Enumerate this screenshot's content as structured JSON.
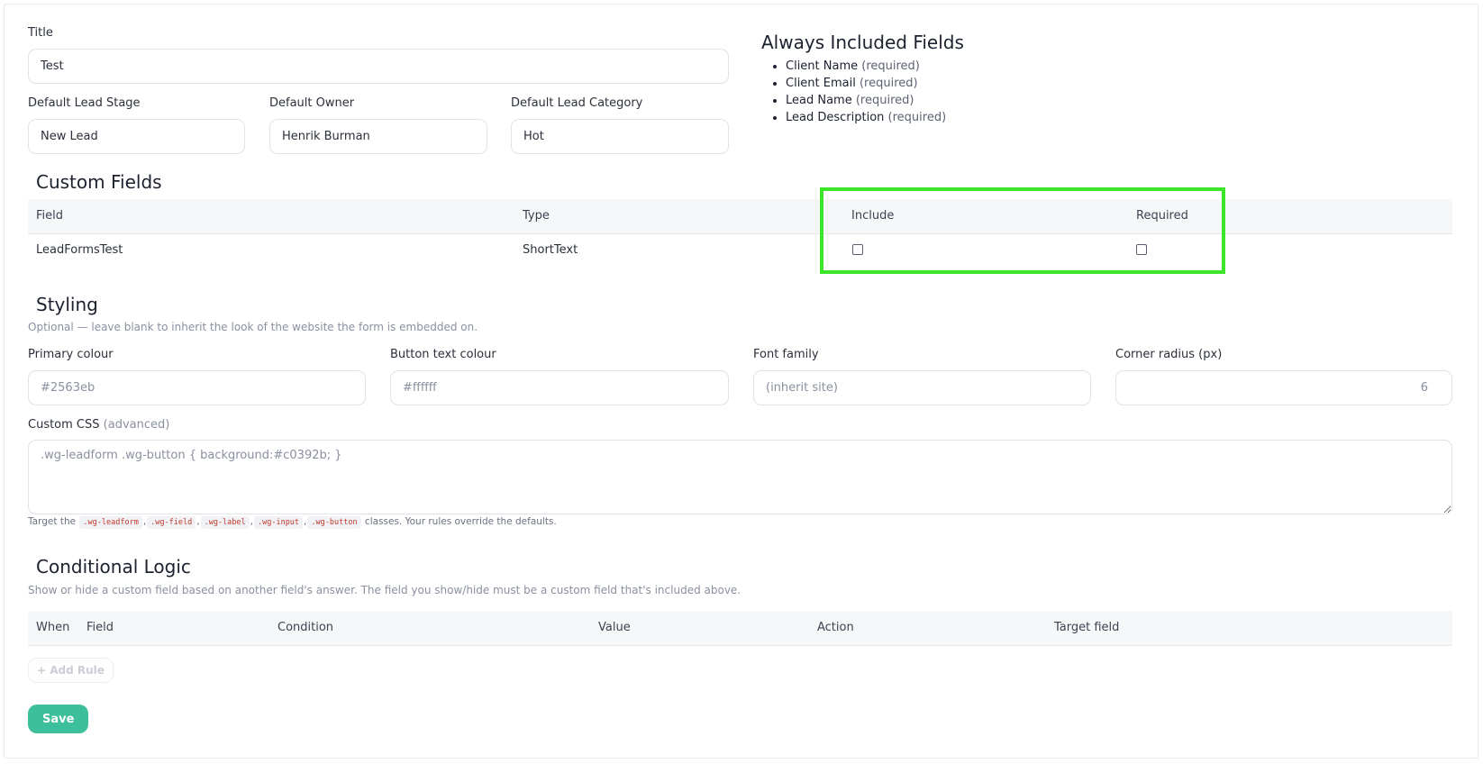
{
  "form": {
    "title_label": "Title",
    "title_value": "Test",
    "lead_stage_label": "Default Lead Stage",
    "lead_stage_value": "New Lead",
    "owner_label": "Default Owner",
    "owner_value": "Henrik Burman",
    "category_label": "Default Lead Category",
    "category_value": "Hot"
  },
  "always_included": {
    "heading": "Always Included Fields",
    "items": [
      {
        "name": "Client Name",
        "note": "(required)"
      },
      {
        "name": "Client Email",
        "note": "(required)"
      },
      {
        "name": "Lead Name",
        "note": "(required)"
      },
      {
        "name": "Lead Description",
        "note": "(required)"
      }
    ]
  },
  "custom_fields": {
    "heading": "Custom Fields",
    "columns": [
      "Field",
      "Type",
      "Include",
      "Required"
    ],
    "rows": [
      {
        "field": "LeadFormsTest",
        "type": "ShortText",
        "include": false,
        "required": false
      }
    ]
  },
  "styling": {
    "heading": "Styling",
    "subtitle": "Optional — leave blank to inherit the look of the website the form is embedded on.",
    "primary_label": "Primary colour",
    "primary_placeholder": "#2563eb",
    "button_text_label": "Button text colour",
    "button_text_placeholder": "#ffffff",
    "font_label": "Font family",
    "font_placeholder": "(inherit site)",
    "radius_label": "Corner radius (px)",
    "radius_value": "6",
    "css_label": "Custom CSS",
    "css_label_note": "(advanced)",
    "css_placeholder": ".wg-leadform .wg-button { background:#c0392b; }",
    "hint_prefix": "Target the",
    "hint_classes": [
      ".wg-leadform",
      ".wg-field",
      ".wg-label",
      ".wg-input",
      ".wg-button"
    ],
    "hint_suffix": "classes. Your rules override the defaults."
  },
  "conditional": {
    "heading": "Conditional Logic",
    "subtitle": "Show or hide a custom field based on another field's answer. The field you show/hide must be a custom field that's included above.",
    "columns": [
      "When",
      "Field",
      "Condition",
      "Value",
      "Action",
      "Target field"
    ],
    "add_rule_label": "+ Add Rule"
  },
  "actions": {
    "save_label": "Save"
  },
  "colors": {
    "accent": "#3cbf9a",
    "highlight": "#3ce42a",
    "code_text": "#c0392b"
  }
}
